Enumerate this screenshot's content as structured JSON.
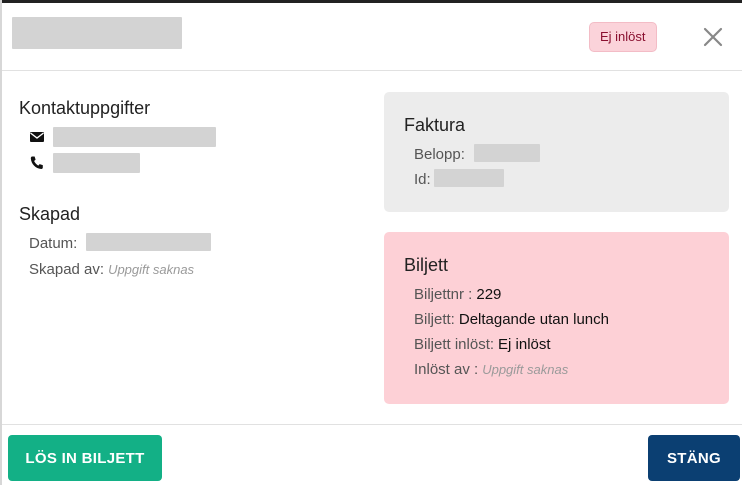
{
  "header": {
    "status_badge": "Ej inlöst"
  },
  "contact": {
    "title": "Kontaktuppgifter",
    "icons": [
      "email-icon",
      "phone-icon"
    ]
  },
  "created": {
    "title": "Skapad",
    "date_label": "Datum:",
    "created_by_label": "Skapad av:",
    "created_by_value": "Uppgift saknas"
  },
  "invoice": {
    "title": "Faktura",
    "amount_label": "Belopp:",
    "id_label": "Id:"
  },
  "ticket": {
    "title": "Biljett",
    "ticket_no_label": "Biljettnr :",
    "ticket_no_value": "229",
    "ticket_label": "Biljett:",
    "ticket_value": "Deltagande utan lunch",
    "redeemed_label": "Biljett inlöst:",
    "redeemed_value": "Ej inlöst",
    "redeemed_by_label": "Inlöst av :",
    "redeemed_by_value": "Uppgift saknas"
  },
  "footer": {
    "redeem_button": "LÖS IN BILJETT",
    "close_button": "STÄNG"
  },
  "colors": {
    "redeem_button": "#13b086",
    "close_button": "#0b3f72",
    "ticket_card": "#fdd0d6",
    "invoice_card": "#ececec",
    "badge_bg": "#fbd3da",
    "badge_text": "#8a1030"
  }
}
